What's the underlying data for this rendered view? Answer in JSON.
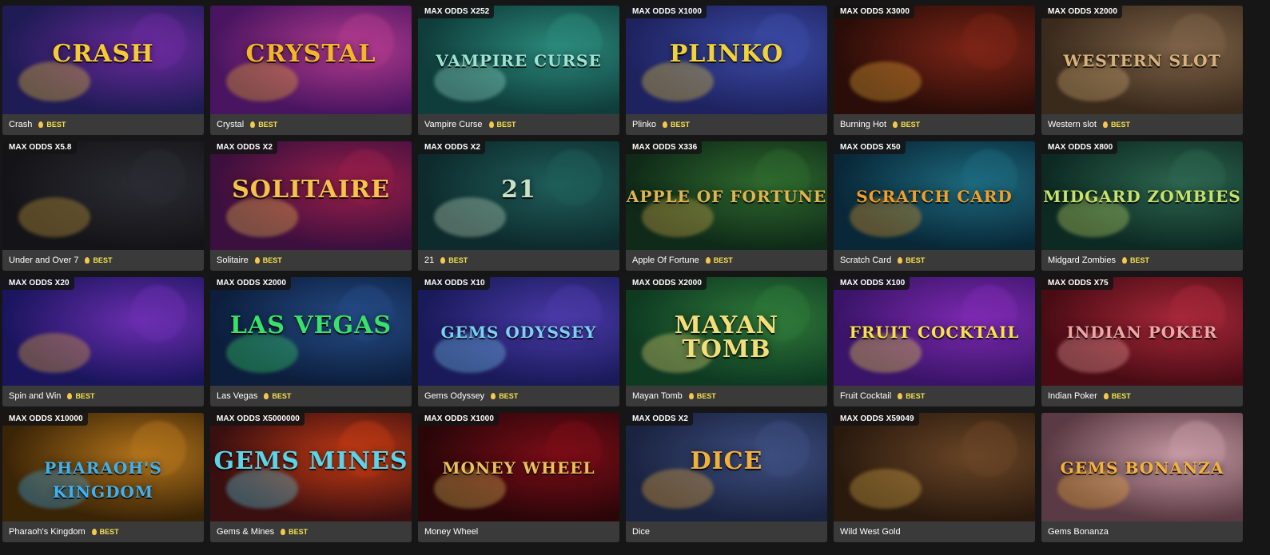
{
  "tiles": [
    {
      "name": "Crash",
      "odds": "",
      "best": "BEST",
      "art_text": "CRASH",
      "colors": [
        "#1f1b55",
        "#6b2a9e",
        "#f7c934"
      ]
    },
    {
      "name": "Crystal",
      "odds": "",
      "best": "BEST",
      "art_text": "CRYSTAL",
      "colors": [
        "#4a1560",
        "#b23a8e",
        "#f4b529"
      ]
    },
    {
      "name": "Vampire Curse",
      "odds": "MAX ODDS X252",
      "best": "BEST",
      "art_text": "VAMPIRE CURSE",
      "colors": [
        "#0f3d3b",
        "#2b8a7c",
        "#9be3d2"
      ]
    },
    {
      "name": "Plinko",
      "odds": "MAX ODDS X1000",
      "best": "BEST",
      "art_text": "Plinko",
      "colors": [
        "#1e2360",
        "#3b4aa5",
        "#f1d23a"
      ]
    },
    {
      "name": "Burning Hot",
      "odds": "MAX ODDS X3000",
      "best": "BEST",
      "art_text": "",
      "colors": [
        "#2a0d08",
        "#7c2416",
        "#f0b33a"
      ]
    },
    {
      "name": "Western slot",
      "odds": "MAX ODDS X2000",
      "best": "BEST",
      "art_text": "WESTERN SLOT",
      "colors": [
        "#3a2a1c",
        "#7e6348",
        "#d8b27a"
      ]
    },
    {
      "name": "Under and Over 7",
      "odds": "MAX ODDS X5.8",
      "best": "BEST",
      "art_text": "",
      "colors": [
        "#141418",
        "#2b2b33",
        "#d2a641"
      ]
    },
    {
      "name": "Solitaire",
      "odds": "MAX ODDS X2",
      "best": "BEST",
      "art_text": "SOLITAIRE",
      "colors": [
        "#3b0f3e",
        "#9a1f4a",
        "#f5c24a"
      ]
    },
    {
      "name": "21",
      "odds": "MAX ODDS X2",
      "best": "BEST",
      "art_text": "21",
      "colors": [
        "#0d2a2c",
        "#1f5e5a",
        "#c9e2c6"
      ]
    },
    {
      "name": "Apple Of Fortune",
      "odds": "MAX ODDS X336",
      "best": "BEST",
      "art_text": "APPLE OF FORTUNE",
      "colors": [
        "#0f2a18",
        "#2f6a2e",
        "#e0b450"
      ]
    },
    {
      "name": "Scratch Card",
      "odds": "MAX ODDS X50",
      "best": "BEST",
      "art_text": "SCRATCH CARD",
      "colors": [
        "#082838",
        "#1e6a7e",
        "#f0a02a"
      ]
    },
    {
      "name": "Midgard Zombies",
      "odds": "MAX ODDS X800",
      "best": "BEST",
      "art_text": "MIDGARD ZOMBIES",
      "colors": [
        "#0d2a22",
        "#2d6650",
        "#c7e26b"
      ]
    },
    {
      "name": "Spin and Win",
      "odds": "MAX ODDS X20",
      "best": "BEST",
      "art_text": "",
      "colors": [
        "#1b155e",
        "#6b2eb0",
        "#f1b23c"
      ]
    },
    {
      "name": "Las Vegas",
      "odds": "MAX ODDS X2000",
      "best": "BEST",
      "art_text": "Las Vegas",
      "colors": [
        "#0c1e3c",
        "#254b86",
        "#39e06a"
      ]
    },
    {
      "name": "Gems Odyssey",
      "odds": "MAX ODDS X10",
      "best": "BEST",
      "art_text": "GEMS ODYSSEY",
      "colors": [
        "#1a1a5a",
        "#4a3aa8",
        "#7ad0f5"
      ]
    },
    {
      "name": "Mayan Tomb",
      "odds": "MAX ODDS X2000",
      "best": "BEST",
      "art_text": "MAYAN TOMB",
      "colors": [
        "#0e3a22",
        "#2f7a3a",
        "#f2df7a"
      ]
    },
    {
      "name": "Fruit Cocktail",
      "odds": "MAX ODDS X100",
      "best": "BEST",
      "art_text": "FRUIT COCKTAIL",
      "colors": [
        "#3a1468",
        "#7e2ab2",
        "#f7e24a"
      ]
    },
    {
      "name": "Indian Poker",
      "odds": "MAX ODDS X75",
      "best": "BEST",
      "art_text": "Indian Poker",
      "colors": [
        "#4a0c14",
        "#a8283a",
        "#f0a6a6"
      ]
    },
    {
      "name": "Pharaoh's Kingdom",
      "odds": "MAX ODDS X10000",
      "best": "BEST",
      "art_text": "PHARAOH'S KINGDOM",
      "colors": [
        "#3a2406",
        "#b3741c",
        "#3fb0f0"
      ]
    },
    {
      "name": "Gems & Mines",
      "odds": "MAX ODDS X5000000",
      "best": "BEST",
      "art_text": "GEMS MINES",
      "colors": [
        "#3a0f10",
        "#c23a14",
        "#5ad4e8"
      ]
    },
    {
      "name": "Money Wheel",
      "odds": "MAX ODDS X1000",
      "best": "",
      "art_text": "MONEY WHEEL",
      "colors": [
        "#2a0609",
        "#7c0d17",
        "#e7c25a"
      ]
    },
    {
      "name": "Dice",
      "odds": "MAX ODDS X2",
      "best": "",
      "art_text": "DICE",
      "colors": [
        "#1a2340",
        "#3d4e80",
        "#f2b03a"
      ]
    },
    {
      "name": "Wild West Gold",
      "odds": "MAX ODDS X59049",
      "best": "",
      "art_text": "",
      "colors": [
        "#2a1a0e",
        "#6a4526",
        "#e0b24a"
      ]
    },
    {
      "name": "Gems Bonanza",
      "odds": "",
      "best": "",
      "art_text": "GEMS BONANZA",
      "colors": [
        "#5a3a44",
        "#c79aa4",
        "#f4b23a"
      ]
    }
  ]
}
